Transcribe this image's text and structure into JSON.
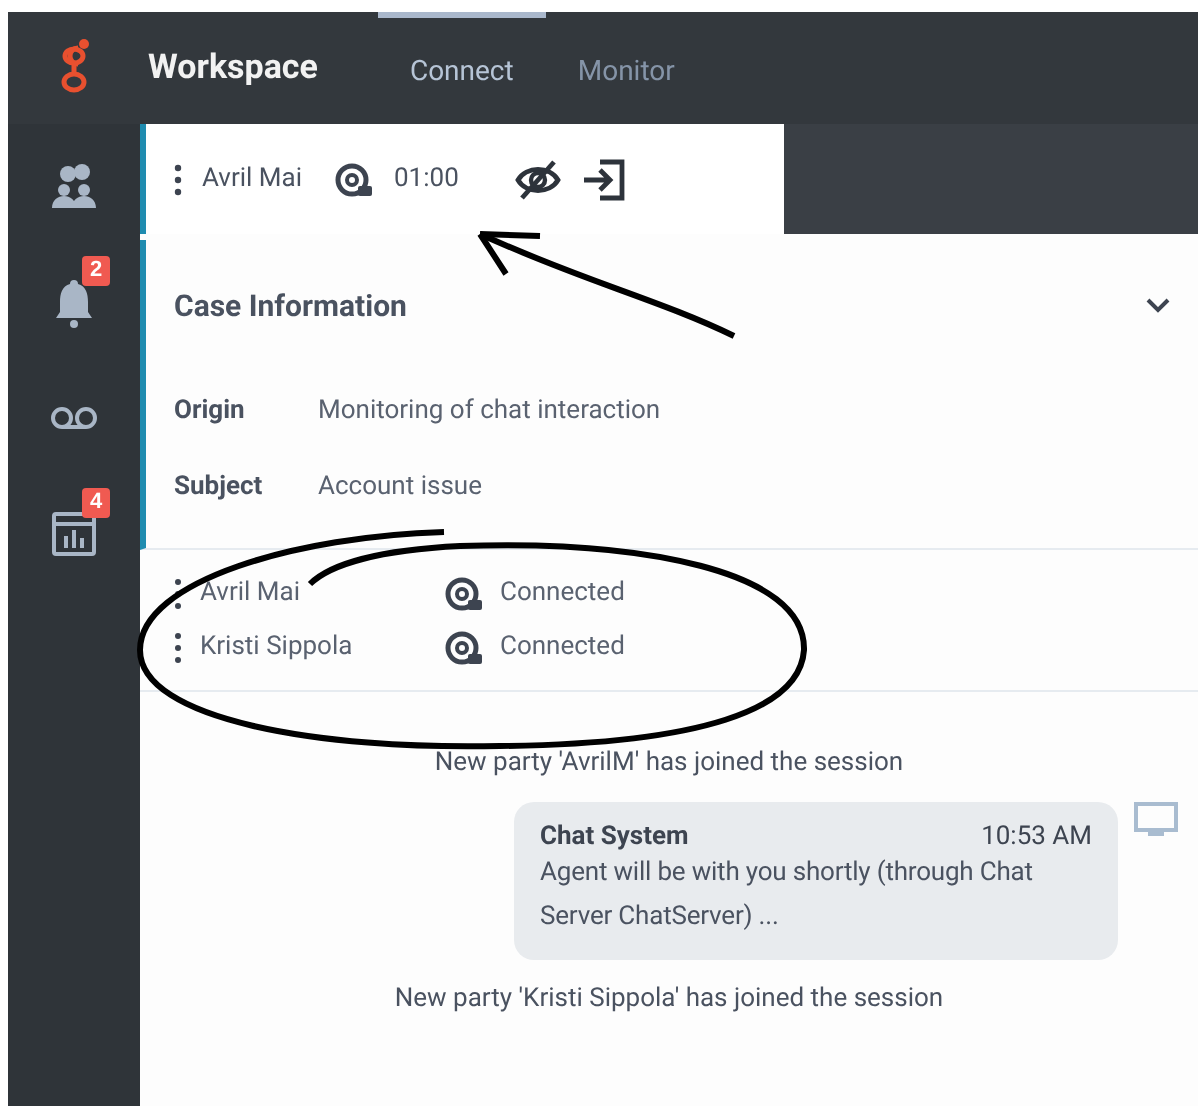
{
  "app": {
    "title": "Workspace"
  },
  "tabs": [
    {
      "label": "Connect",
      "selected": true
    },
    {
      "label": "Monitor",
      "selected": false
    }
  ],
  "sidebar": {
    "items": [
      {
        "kind": "team"
      },
      {
        "kind": "bell",
        "badge": "2"
      },
      {
        "kind": "voicemail"
      },
      {
        "kind": "report",
        "badge": "4"
      }
    ]
  },
  "interaction": {
    "name": "Avril Mai",
    "timer": "01:00"
  },
  "case_information": {
    "title": "Case Information",
    "expanded": true,
    "fields": [
      {
        "label": "Origin",
        "value": "Monitoring of chat interaction"
      },
      {
        "label": "Subject",
        "value": "Account issue"
      }
    ]
  },
  "participants": [
    {
      "name": "Avril Mai",
      "status": "Connected"
    },
    {
      "name": "Kristi Sippola",
      "status": "Connected"
    }
  ],
  "transcript": [
    {
      "kind": "system",
      "text": "New party 'AvrilM' has joined the session"
    },
    {
      "kind": "message",
      "sender": "Chat System",
      "time": "10:53 AM",
      "text": "Agent will be with you shortly (through Chat Server ChatServer) ..."
    },
    {
      "kind": "system",
      "text": "New party 'Kristi Sippola' has joined the session"
    }
  ]
}
